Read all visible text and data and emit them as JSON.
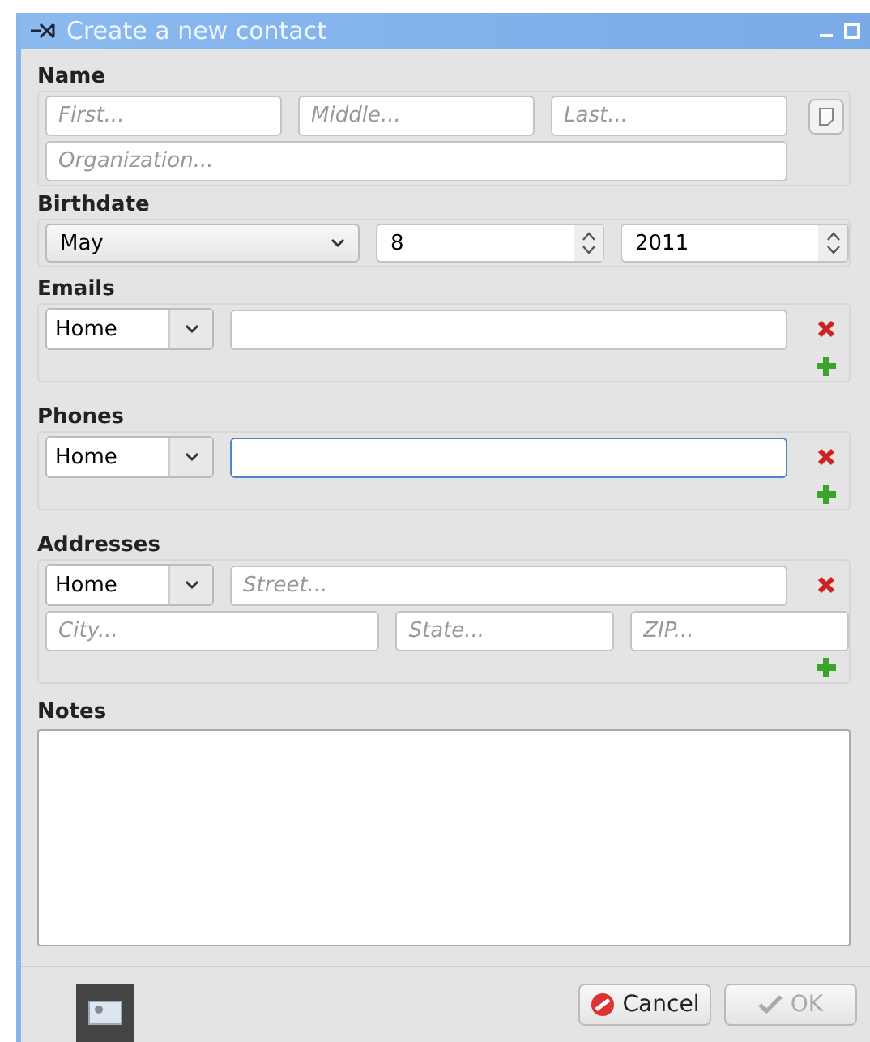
{
  "window": {
    "title": "Create a new contact"
  },
  "name": {
    "label": "Name",
    "first": {
      "placeholder": "First..."
    },
    "middle": {
      "placeholder": "Middle..."
    },
    "last": {
      "placeholder": "Last..."
    },
    "organization": {
      "placeholder": "Organization..."
    }
  },
  "birthdate": {
    "label": "Birthdate",
    "month": "May",
    "day": "8",
    "year": "2011"
  },
  "emails": {
    "label": "Emails",
    "rows": [
      {
        "type": "Home",
        "focused": false
      }
    ]
  },
  "phones": {
    "label": "Phones",
    "rows": [
      {
        "type": "Home",
        "focused": true
      }
    ]
  },
  "addresses": {
    "label": "Addresses",
    "rows": [
      {
        "type": "Home",
        "street": {
          "placeholder": "Street..."
        },
        "city": {
          "placeholder": "City..."
        },
        "state": {
          "placeholder": "State..."
        },
        "zip": {
          "placeholder": "ZIP..."
        }
      }
    ]
  },
  "notes": {
    "label": "Notes"
  },
  "buttons": [
    {
      "kind": "cancel",
      "label": "Cancel",
      "disabled": false
    },
    {
      "kind": "ok",
      "label": "OK",
      "disabled": true
    }
  ]
}
